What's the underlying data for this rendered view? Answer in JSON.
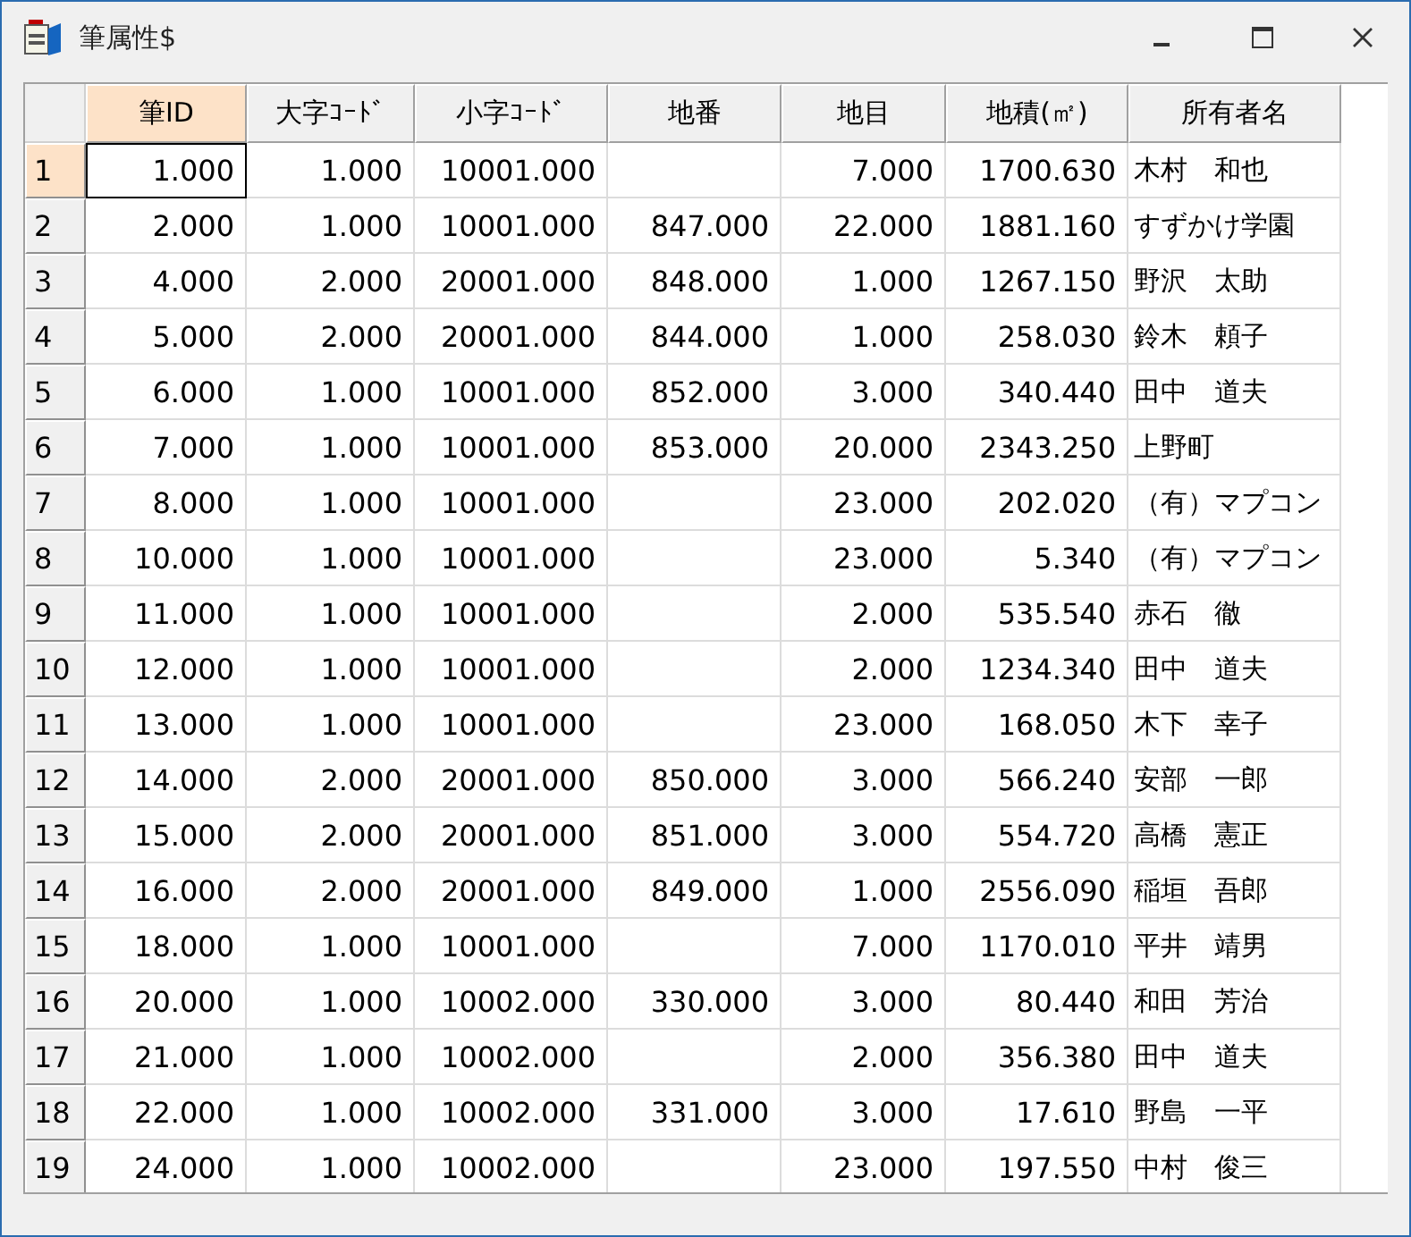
{
  "window": {
    "title": "筆属性$"
  },
  "table": {
    "columns": [
      {
        "label": "筆ID",
        "selected": true
      },
      {
        "label": "大字ｺｰﾄﾞ",
        "selected": false
      },
      {
        "label": "小字ｺｰﾄﾞ",
        "selected": false
      },
      {
        "label": "地番",
        "selected": false
      },
      {
        "label": "地目",
        "selected": false
      },
      {
        "label": "地積(㎡)",
        "selected": false
      },
      {
        "label": "所有者名",
        "selected": false
      }
    ],
    "rows": [
      {
        "number": "1",
        "selected": true,
        "cells": [
          "1.000",
          "1.000",
          "10001.000",
          null,
          "7.000",
          "1700.630",
          "木村　和也"
        ]
      },
      {
        "number": "2",
        "selected": false,
        "cells": [
          "2.000",
          "1.000",
          "10001.000",
          "847.000",
          "22.000",
          "1881.160",
          "すずかけ学園"
        ]
      },
      {
        "number": "3",
        "selected": false,
        "cells": [
          "4.000",
          "2.000",
          "20001.000",
          "848.000",
          "1.000",
          "1267.150",
          "野沢　太助"
        ]
      },
      {
        "number": "4",
        "selected": false,
        "cells": [
          "5.000",
          "2.000",
          "20001.000",
          "844.000",
          "1.000",
          "258.030",
          "鈴木　頼子"
        ]
      },
      {
        "number": "5",
        "selected": false,
        "cells": [
          "6.000",
          "1.000",
          "10001.000",
          "852.000",
          "3.000",
          "340.440",
          "田中　道夫"
        ]
      },
      {
        "number": "6",
        "selected": false,
        "cells": [
          "7.000",
          "1.000",
          "10001.000",
          "853.000",
          "20.000",
          "2343.250",
          "上野町"
        ]
      },
      {
        "number": "7",
        "selected": false,
        "cells": [
          "8.000",
          "1.000",
          "10001.000",
          null,
          "23.000",
          "202.020",
          "（有）マプコン"
        ]
      },
      {
        "number": "8",
        "selected": false,
        "cells": [
          "10.000",
          "1.000",
          "10001.000",
          null,
          "23.000",
          "5.340",
          "（有）マプコン"
        ]
      },
      {
        "number": "9",
        "selected": false,
        "cells": [
          "11.000",
          "1.000",
          "10001.000",
          null,
          "2.000",
          "535.540",
          "赤石　徹"
        ]
      },
      {
        "number": "10",
        "selected": false,
        "cells": [
          "12.000",
          "1.000",
          "10001.000",
          null,
          "2.000",
          "1234.340",
          "田中　道夫"
        ]
      },
      {
        "number": "11",
        "selected": false,
        "cells": [
          "13.000",
          "1.000",
          "10001.000",
          null,
          "23.000",
          "168.050",
          "木下　幸子"
        ]
      },
      {
        "number": "12",
        "selected": false,
        "cells": [
          "14.000",
          "2.000",
          "20001.000",
          "850.000",
          "3.000",
          "566.240",
          "安部　一郎"
        ]
      },
      {
        "number": "13",
        "selected": false,
        "cells": [
          "15.000",
          "2.000",
          "20001.000",
          "851.000",
          "3.000",
          "554.720",
          "高橋　憲正"
        ]
      },
      {
        "number": "14",
        "selected": false,
        "cells": [
          "16.000",
          "2.000",
          "20001.000",
          "849.000",
          "1.000",
          "2556.090",
          "稲垣　吾郎"
        ]
      },
      {
        "number": "15",
        "selected": false,
        "cells": [
          "18.000",
          "1.000",
          "10001.000",
          null,
          "7.000",
          "1170.010",
          "平井　靖男"
        ]
      },
      {
        "number": "16",
        "selected": false,
        "cells": [
          "20.000",
          "1.000",
          "10002.000",
          "330.000",
          "3.000",
          "80.440",
          "和田　芳治"
        ]
      },
      {
        "number": "17",
        "selected": false,
        "cells": [
          "21.000",
          "1.000",
          "10002.000",
          null,
          "2.000",
          "356.380",
          "田中　道夫"
        ]
      },
      {
        "number": "18",
        "selected": false,
        "cells": [
          "22.000",
          "1.000",
          "10002.000",
          "331.000",
          "3.000",
          "17.610",
          "野島　一平"
        ]
      },
      {
        "number": "19",
        "selected": false,
        "cells": [
          "24.000",
          "1.000",
          "10002.000",
          null,
          "23.000",
          "197.550",
          "中村　俊三"
        ]
      }
    ]
  }
}
